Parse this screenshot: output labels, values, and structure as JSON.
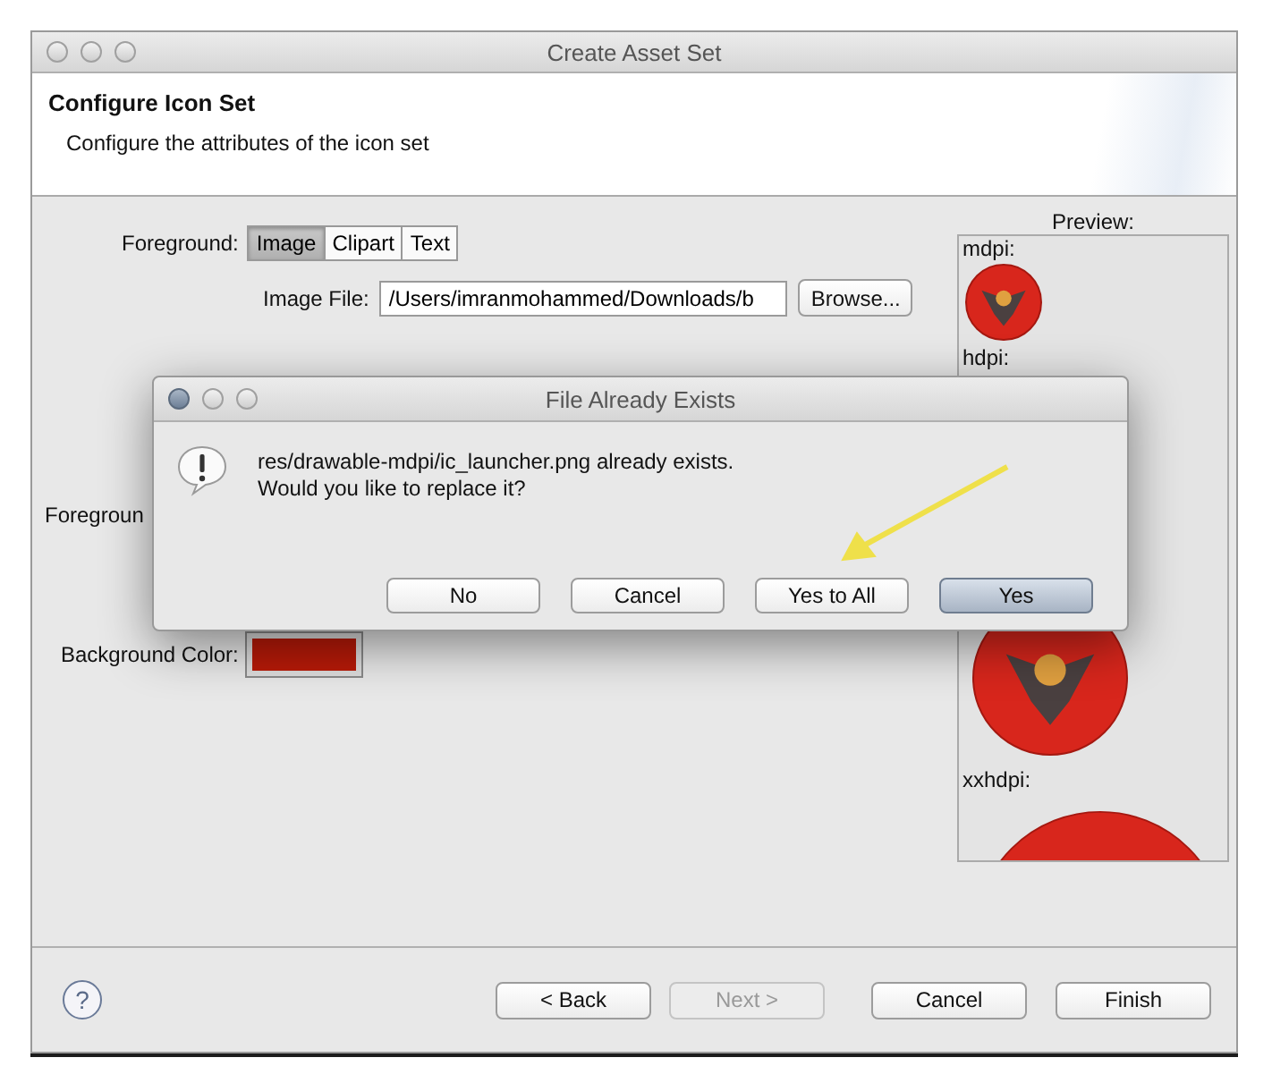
{
  "window": {
    "title": "Create Asset Set"
  },
  "header": {
    "title": "Configure Icon Set",
    "subtitle": "Configure the attributes of the icon set"
  },
  "foreground": {
    "label": "Foreground:",
    "tabs": [
      {
        "label": "Image",
        "selected": true
      },
      {
        "label": "Clipart",
        "selected": false
      },
      {
        "label": "Text",
        "selected": false
      }
    ]
  },
  "image_file": {
    "label": "Image File:",
    "value": "/Users/imranmohammed/Downloads/b",
    "button": "Browse..."
  },
  "foreground_partial_label": "Foregroun",
  "background_color": {
    "label": "Background Color:",
    "color": "#b81a08"
  },
  "preview": {
    "title": "Preview:",
    "densities": [
      "mdpi:",
      "hdpi:",
      "xxhdpi:"
    ]
  },
  "dialog": {
    "title": "File Already Exists",
    "message": "res/drawable-mdpi/ic_launcher.png already exists.\nWould you like to replace it?",
    "buttons": [
      {
        "label": "No",
        "default": false
      },
      {
        "label": "Cancel",
        "default": false
      },
      {
        "label": "Yes to All",
        "default": false
      },
      {
        "label": "Yes",
        "default": true
      }
    ]
  },
  "footer": {
    "help": "?",
    "buttons": [
      {
        "label": "< Back",
        "disabled": false
      },
      {
        "label": "Next >",
        "disabled": true
      },
      {
        "label": "Cancel",
        "disabled": false
      },
      {
        "label": "Finish",
        "disabled": false
      }
    ]
  }
}
